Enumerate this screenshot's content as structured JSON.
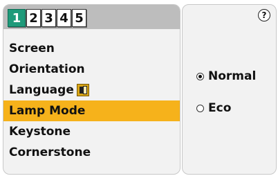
{
  "tabs": [
    "1",
    "2",
    "3",
    "4",
    "5"
  ],
  "active_tab": "1",
  "menu": {
    "items": [
      "Screen",
      "Orientation",
      "Language",
      "Lamp Mode",
      "Keystone",
      "Cornerstone"
    ],
    "highlight_index": 3
  },
  "help_label": "?",
  "lamp_modes": {
    "options": [
      "Normal",
      "Eco"
    ],
    "selected": "Normal"
  },
  "colors": {
    "active_tab": "#1f9a7a",
    "highlight": "#f6b21b",
    "tab_bar": "#bdbdbd",
    "panel": "#f2f2f2"
  },
  "icons": {
    "language": "language-icon",
    "help": "help-icon",
    "radio": "radio-icon"
  }
}
